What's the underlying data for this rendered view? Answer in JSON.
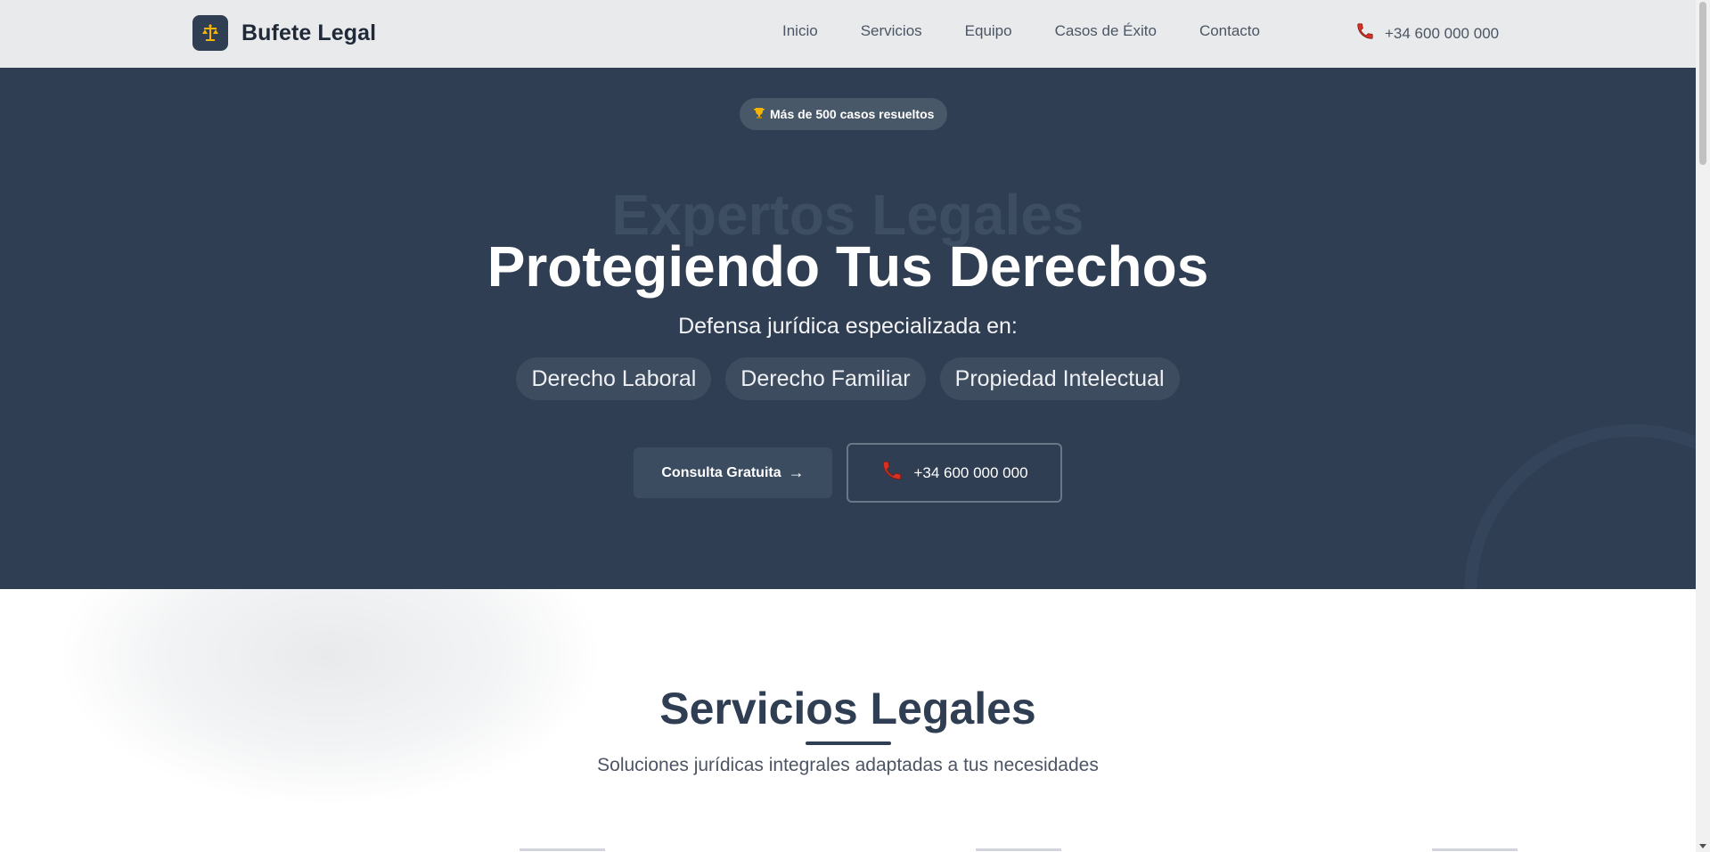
{
  "header": {
    "brand": "Bufete Legal",
    "logo_icon": "scales-of-justice-icon",
    "nav": [
      {
        "label": "Inicio"
      },
      {
        "label": "Servicios"
      },
      {
        "label": "Equipo"
      },
      {
        "label": "Casos de Éxito"
      },
      {
        "label": "Contacto"
      }
    ],
    "phone": "+34 600 000 000",
    "phone_icon": "telephone-icon"
  },
  "hero": {
    "badge_icon": "trophy-icon",
    "badge_text": "Más de 500 casos resueltos",
    "ghost_title": "Expertos Legales",
    "title": "Protegiendo Tus Derechos",
    "subtitle": "Defensa jurídica especializada en:",
    "specialties": [
      "Derecho Laboral",
      "Derecho Familiar",
      "Propiedad Intelectual"
    ],
    "cta_primary": "Consulta Gratuita",
    "cta_arrow": "→",
    "cta_phone": "+34 600 000 000"
  },
  "services": {
    "title": "Servicios Legales",
    "subtitle": "Soluciones jurídicas integrales adaptadas a tus necesidades"
  },
  "colors": {
    "primary": "#2f3e52",
    "header_bg": "#e9eaec",
    "accent_gold": "#f4b400",
    "phone_red": "#d93025"
  }
}
